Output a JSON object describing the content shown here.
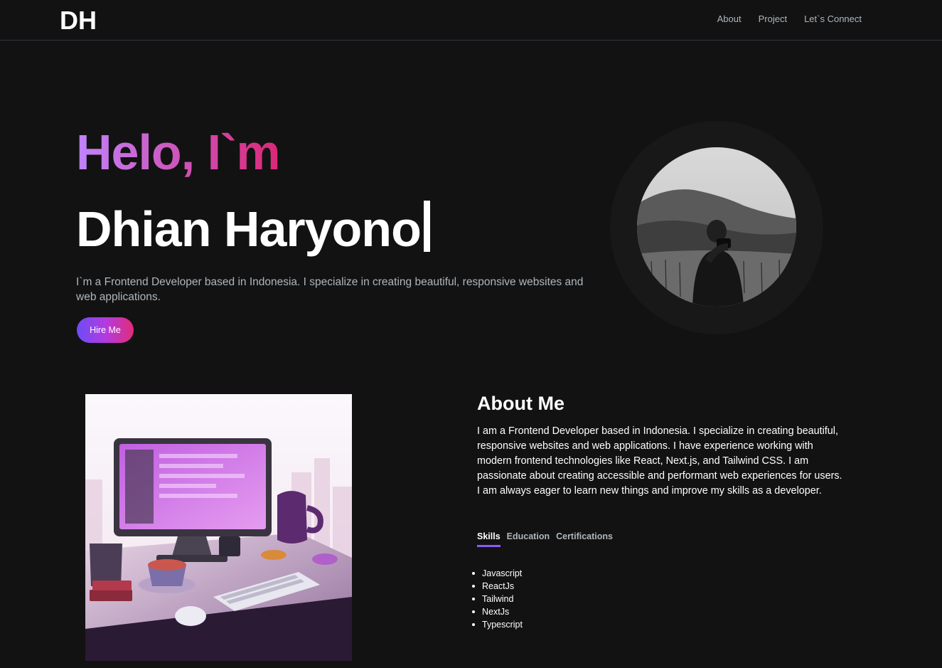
{
  "nav": {
    "logo": "DH",
    "links": [
      "About",
      "Project",
      "Let`s Connect"
    ]
  },
  "hero": {
    "greeting": "Helo, I`m",
    "name": "Dhian Haryono",
    "description": "I`m a Frontend Developer based in Indonesia. I specialize in creating beautiful, responsive websites and web applications.",
    "cta_label": "Hire Me"
  },
  "about": {
    "title": "About Me",
    "text": "I am a Frontend Developer based in Indonesia. I specialize in creating beautiful, responsive websites and web applications. I have experience working with modern frontend technologies like React, Next.js, and Tailwind CSS. I am passionate about creating accessible and performant web experiences for users. I am always eager to learn new things and improve my skills as a developer.",
    "tabs": [
      "Skills",
      "Education",
      "Certifications"
    ],
    "active_tab": "Skills",
    "skills": [
      "Javascript",
      "ReactJs",
      "Tailwind",
      "NextJs",
      "Typescript"
    ]
  },
  "colors": {
    "background": "#121212",
    "accent_purple": "#8b5cf6",
    "gradient_start": "#c084fc",
    "gradient_end": "#db2777",
    "muted_text": "#adb7be"
  }
}
